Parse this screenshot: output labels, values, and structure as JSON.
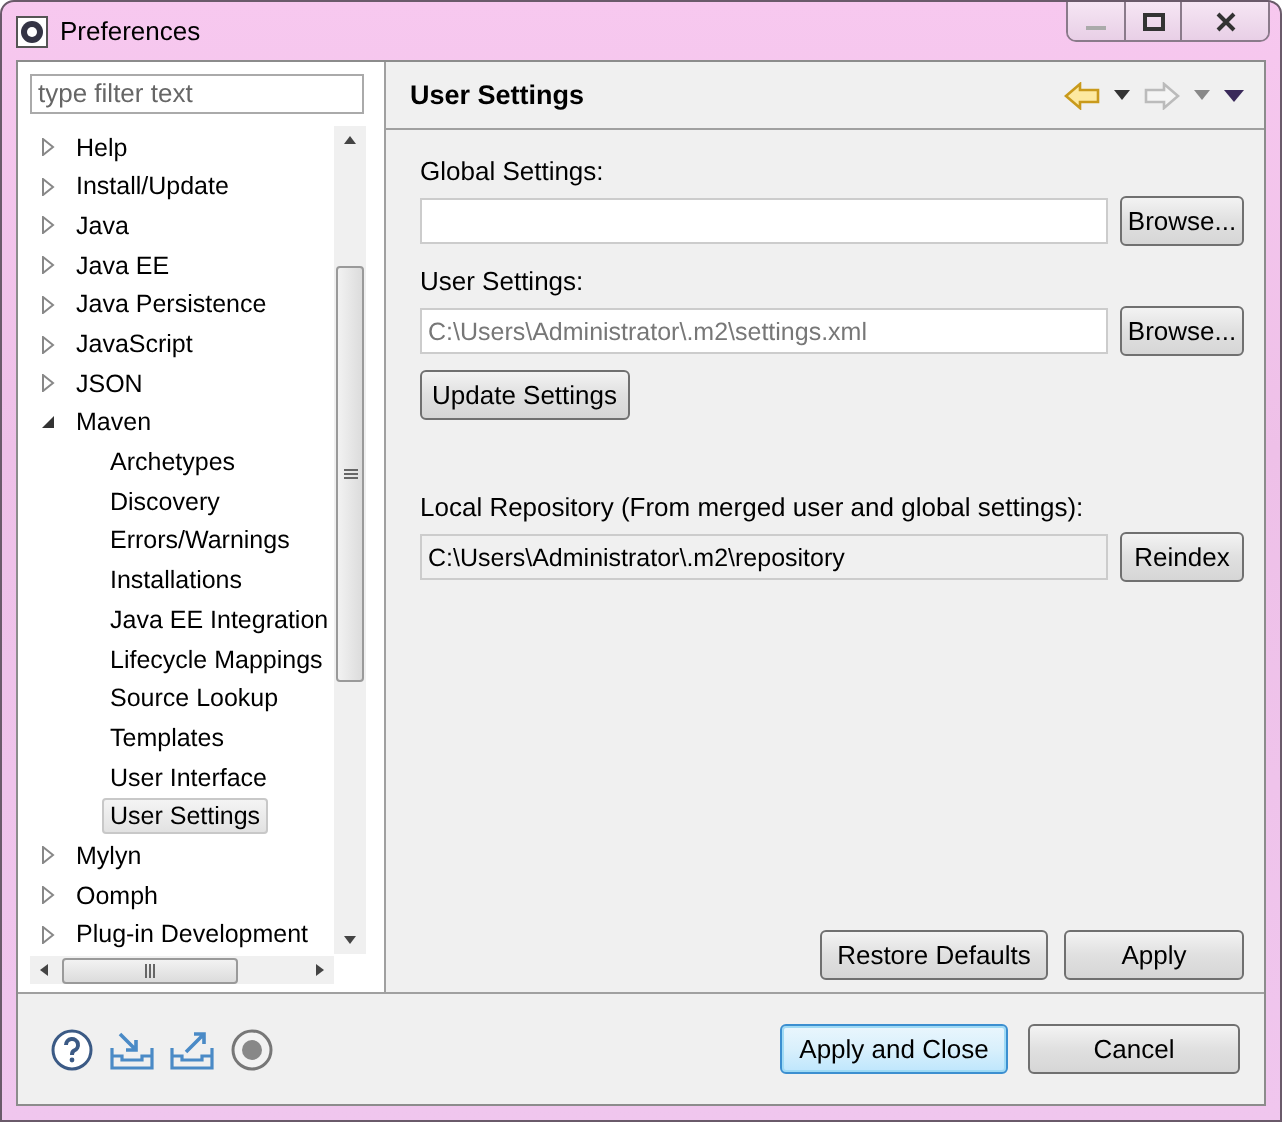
{
  "window": {
    "title": "Preferences"
  },
  "filter": {
    "placeholder": "type filter text"
  },
  "tree": [
    {
      "label": "Help",
      "expanded": false,
      "selected": false
    },
    {
      "label": "Install/Update",
      "expanded": false,
      "selected": false
    },
    {
      "label": "Java",
      "expanded": false,
      "selected": false
    },
    {
      "label": "Java EE",
      "expanded": false,
      "selected": false
    },
    {
      "label": "Java Persistence",
      "expanded": false,
      "selected": false
    },
    {
      "label": "JavaScript",
      "expanded": false,
      "selected": false
    },
    {
      "label": "JSON",
      "expanded": false,
      "selected": false
    },
    {
      "label": "Maven",
      "expanded": true,
      "selected": false,
      "children": [
        {
          "label": "Archetypes",
          "selected": false
        },
        {
          "label": "Discovery",
          "selected": false
        },
        {
          "label": "Errors/Warnings",
          "selected": false
        },
        {
          "label": "Installations",
          "selected": false
        },
        {
          "label": "Java EE Integration",
          "selected": false
        },
        {
          "label": "Lifecycle Mappings",
          "selected": false
        },
        {
          "label": "Source Lookup",
          "selected": false
        },
        {
          "label": "Templates",
          "selected": false
        },
        {
          "label": "User Interface",
          "selected": false
        },
        {
          "label": "User Settings",
          "selected": true
        }
      ]
    },
    {
      "label": "Mylyn",
      "expanded": false,
      "selected": false
    },
    {
      "label": "Oomph",
      "expanded": false,
      "selected": false
    },
    {
      "label": "Plug-in Development",
      "expanded": false,
      "selected": false
    }
  ],
  "page": {
    "title": "User Settings",
    "back": {
      "disabled": false
    },
    "forward": {
      "disabled": true
    }
  },
  "global_settings": {
    "label": "Global Settings:",
    "button": "Browse..."
  },
  "user_settings": {
    "label": "User Settings:",
    "placeholder": "C:\\Users\\Administrator\\.m2\\settings.xml",
    "button": "Browse..."
  },
  "update_button": "Update Settings",
  "local_repository": {
    "label": "Local Repository (From merged user and global settings):",
    "value": "C:\\Users\\Administrator\\.m2\\repository",
    "read_only": true,
    "button": "Reindex"
  },
  "page_buttons": [
    "Restore Defaults",
    "Apply"
  ],
  "dialog_buttons": [
    {
      "label": "Apply and Close",
      "default": true
    },
    {
      "label": "Cancel",
      "default": false
    }
  ]
}
